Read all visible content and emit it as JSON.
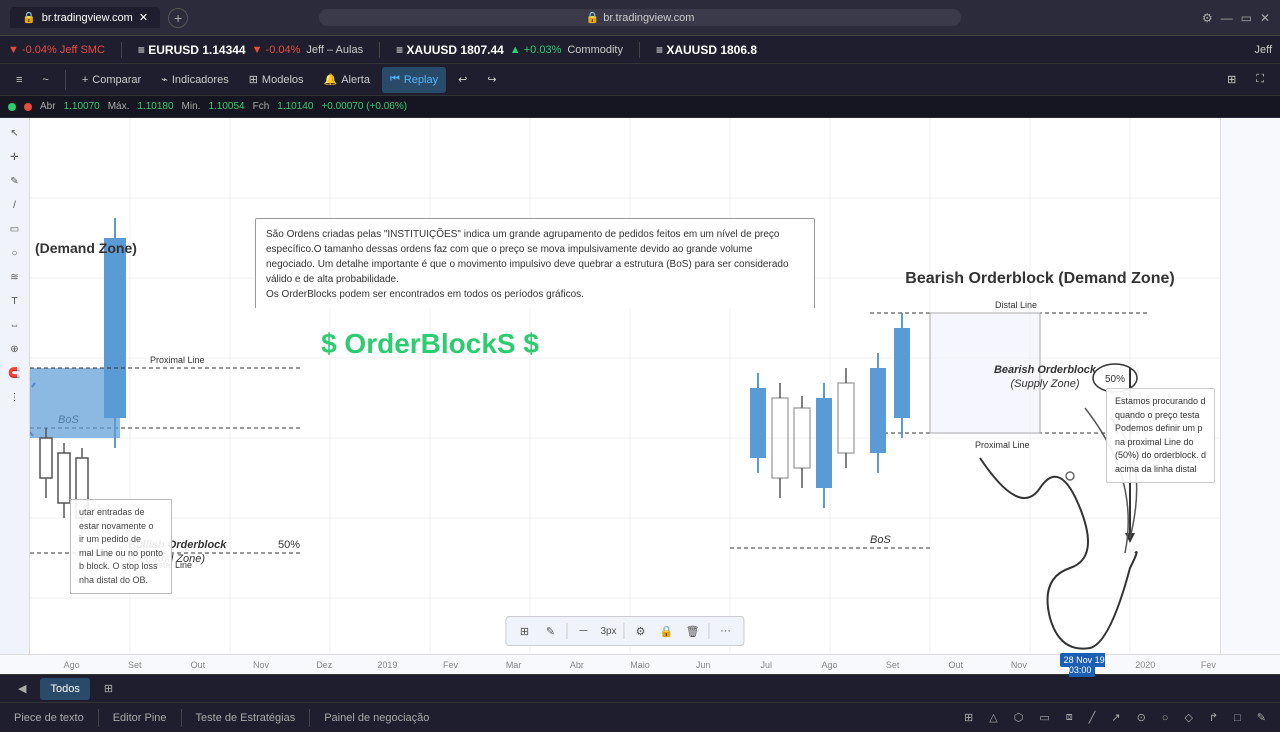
{
  "browser": {
    "url": "br.tradingview.com",
    "tabs": [
      {
        "label": "br.tradingview.com",
        "active": true
      }
    ]
  },
  "header": {
    "left_symbol": "EURUSD",
    "left_price": "1.14344",
    "left_change": "▼ -0.04%",
    "left_change_class": "red",
    "left_label": "Jeff – Aulas",
    "right_symbol1": "XAUUSD",
    "right_price1": "1807.44",
    "right_change1": "▲ +0.03%",
    "right_change1_class": "green",
    "right_label1": "Commodity",
    "right_symbol2": "XAUUSD",
    "right_price2": "1806.8",
    "right_label2": ""
  },
  "toolbar": {
    "compare_label": "Comparar",
    "indicators_label": "Indicadores",
    "models_label": "Modelos",
    "alert_label": "Alerta",
    "replay_label": "Replay"
  },
  "ohlc": {
    "abr": "Abr",
    "abr_val": "1.10070",
    "max": "Máx.",
    "max_val": "1.10180",
    "min": "Min.",
    "min_val": "1.10054",
    "fch": "Fch",
    "fch_val": "1.10140",
    "change": "+0.00070 (+0.06%)"
  },
  "chart": {
    "demand_zone_label": "(Demand Zone)",
    "order_blocks_title": "$ OrderBlockS $",
    "info_text": "São Ordens criadas pelas \"INSTITUIÇÕES\" indica um grande agrupamento de pedidos feitos em um nível de preço específico.O tamanho dessas ordens faz com que o preço se mova impulsivamente devido ao grande volume negociado. Um detalhe importante é que o movimento impulsivo deve quebrar a estrutura (BoS) para ser considerado válido e de alta probabilidade.\nOs OrderBlocks podem ser encontrados em todos os períodos gráficos.",
    "bullish_ob_label": "Bullish Orderblock",
    "bullish_ob_sub": "(Demand Zone)",
    "bullish_50": "50%",
    "proximal_line": "Proximal Line",
    "distal_line": "Distal Line",
    "bos_label": "BoS",
    "bearish_title": "Bearish Orderblock (Demand Zone)",
    "bearish_ob_label": "Bearish Orderblock",
    "bearish_ob_sub": "(Supply Zone)",
    "bearish_50": "50%",
    "bearish_proximal": "Proximal Line",
    "bearish_distal": "Distal Line",
    "bearish_bos": "BoS",
    "bottom_left_text": "utar entradas de\nestar novamente o\nir um pedido de\nmal Line ou no ponto\nb block. O stop loss\nnha distal do OB.",
    "right_popup_text": "Estamos procurando d\nquando o preço testa\nPodemos definir um p\nna proximal Line do\n(50%) do orderblock. d\nacima da linha distal"
  },
  "timeline": {
    "labels": [
      "Ago",
      "Set",
      "Out",
      "Nov",
      "Dez",
      "2019",
      "Fev",
      "Mar",
      "Abr",
      "Maio",
      "Jun",
      "Jul",
      "Ago",
      "Set",
      "Out",
      "Nov",
      "2020",
      "Fev"
    ],
    "highlight": "28 Nov 19  03:00"
  },
  "bottom_tabs": {
    "todos_label": "Todos",
    "tabs": [
      {
        "label": "Piece de texto",
        "active": true
      },
      {
        "label": "Editor Pine"
      },
      {
        "label": "Teste de Estratégias"
      },
      {
        "label": "Painel de negociação"
      }
    ]
  },
  "drawing_tools": {
    "color_label": "3px"
  },
  "icons": {
    "cursor": "↖",
    "crosshair": "✛",
    "pencil": "✎",
    "line": "─",
    "rect": "▭",
    "circle": "○",
    "text": "T",
    "eraser": "⌦",
    "more": "···",
    "settings": "⚙",
    "lock": "🔒",
    "trash": "🗑",
    "arrow_back": "↩",
    "arrow_forward": "↪",
    "magnet": "⊕",
    "zoom_in": "+",
    "compare": "≈",
    "camera": "📷",
    "fullscreen": "⛶"
  }
}
